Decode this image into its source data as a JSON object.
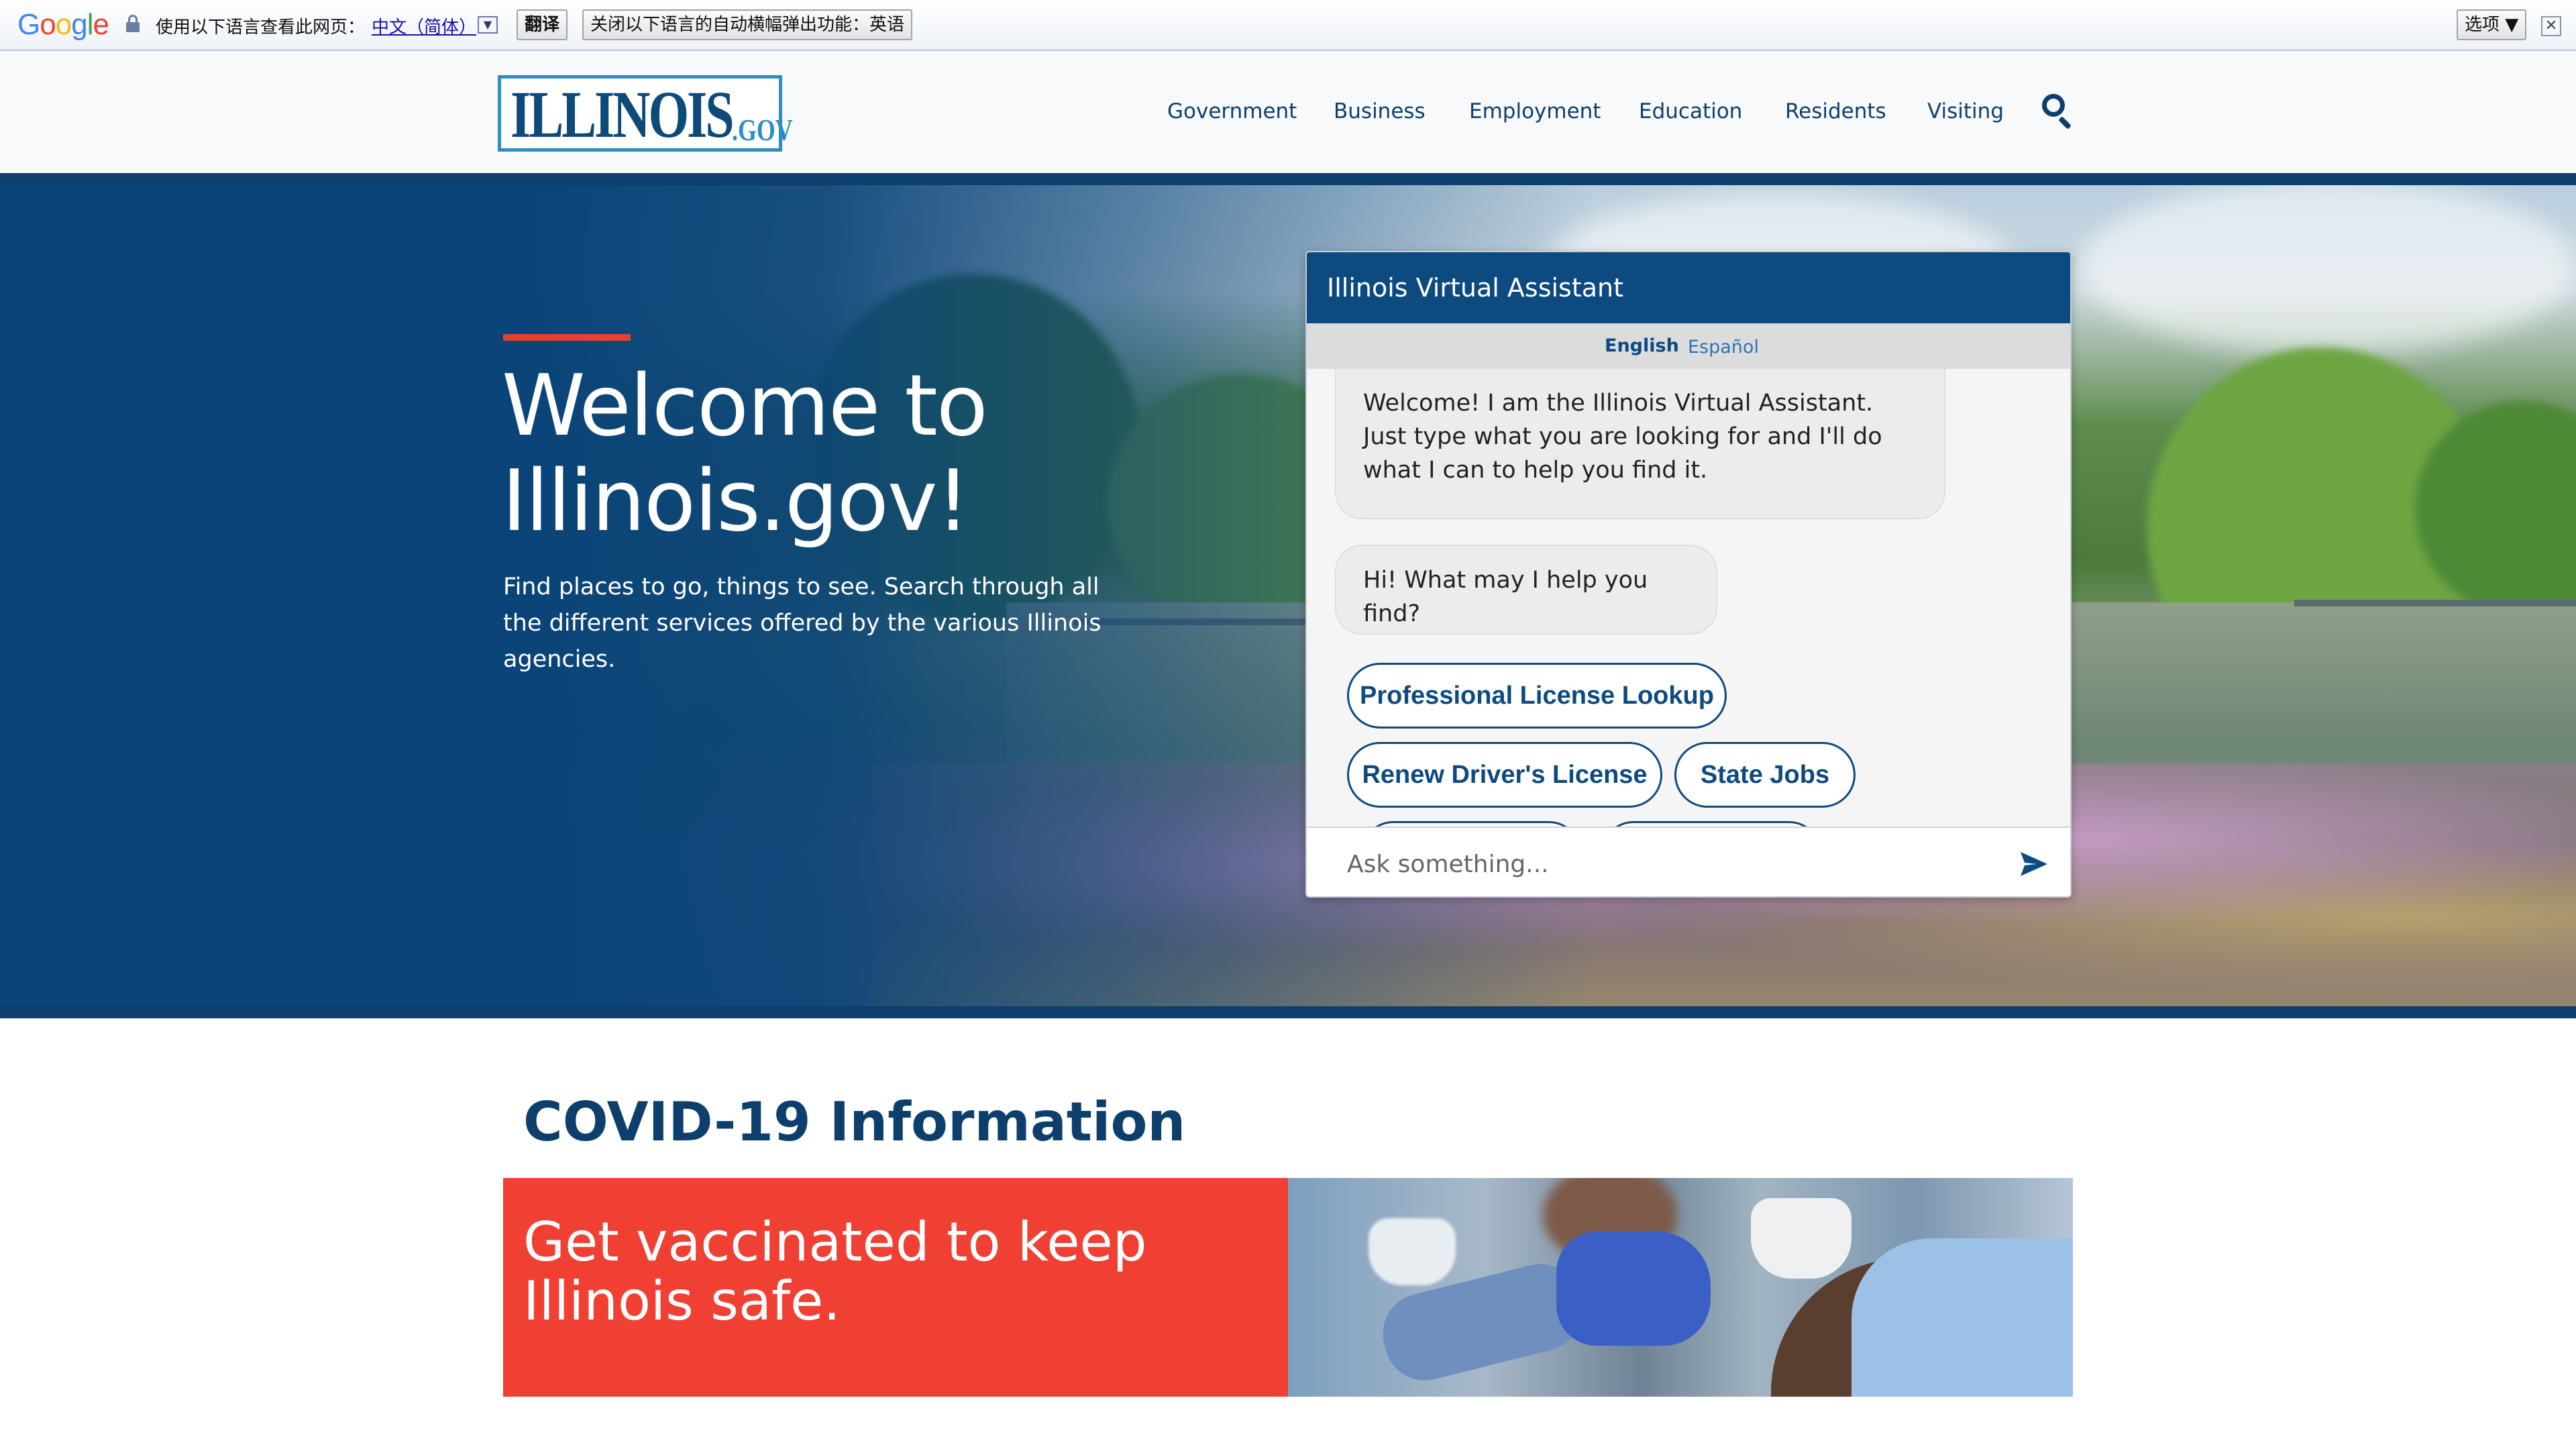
{
  "translate_bar": {
    "logo": "Google",
    "prompt": "使用以下语言查看此网页：",
    "language": "中文（简体）",
    "dropdown_glyph": "▼",
    "translate_button": "翻译",
    "turn_off_button": "关闭以下语言的自动横幅弹出功能：英语",
    "options_button": "选项 ▼",
    "close_glyph": "✕"
  },
  "header": {
    "logo_text": "ILLINOIS",
    "logo_suffix": ".GOV",
    "nav": [
      "Government",
      "Business",
      "Employment",
      "Education",
      "Residents",
      "Visiting"
    ],
    "search_icon": "search-icon"
  },
  "hero": {
    "title": "Welcome to Illinois.gov!",
    "subtitle": "Find places to go, things to see. Search through all the different services offered by the various Illinois agencies."
  },
  "chat": {
    "title": "Illinois Virtual Assistant",
    "lang_english": "English",
    "lang_spanish": "Español",
    "messages": [
      "Welcome! I am the Illinois Virtual Assistant. Just type what you are looking for and I'll do what I can to help you find it.",
      "Hi! What may I help you find?"
    ],
    "quick_replies": [
      "Professional License Lookup",
      "Renew Driver's License",
      "State Jobs"
    ],
    "input_placeholder": "Ask something...",
    "send_icon": "send-icon"
  },
  "covid": {
    "heading": "COVID-19 Information",
    "card_text": "Get vaccinated to keep Illinois safe."
  },
  "colors": {
    "brand_blue": "#0d4a80",
    "accent_red": "#e1432f",
    "covid_red": "#f04034"
  }
}
